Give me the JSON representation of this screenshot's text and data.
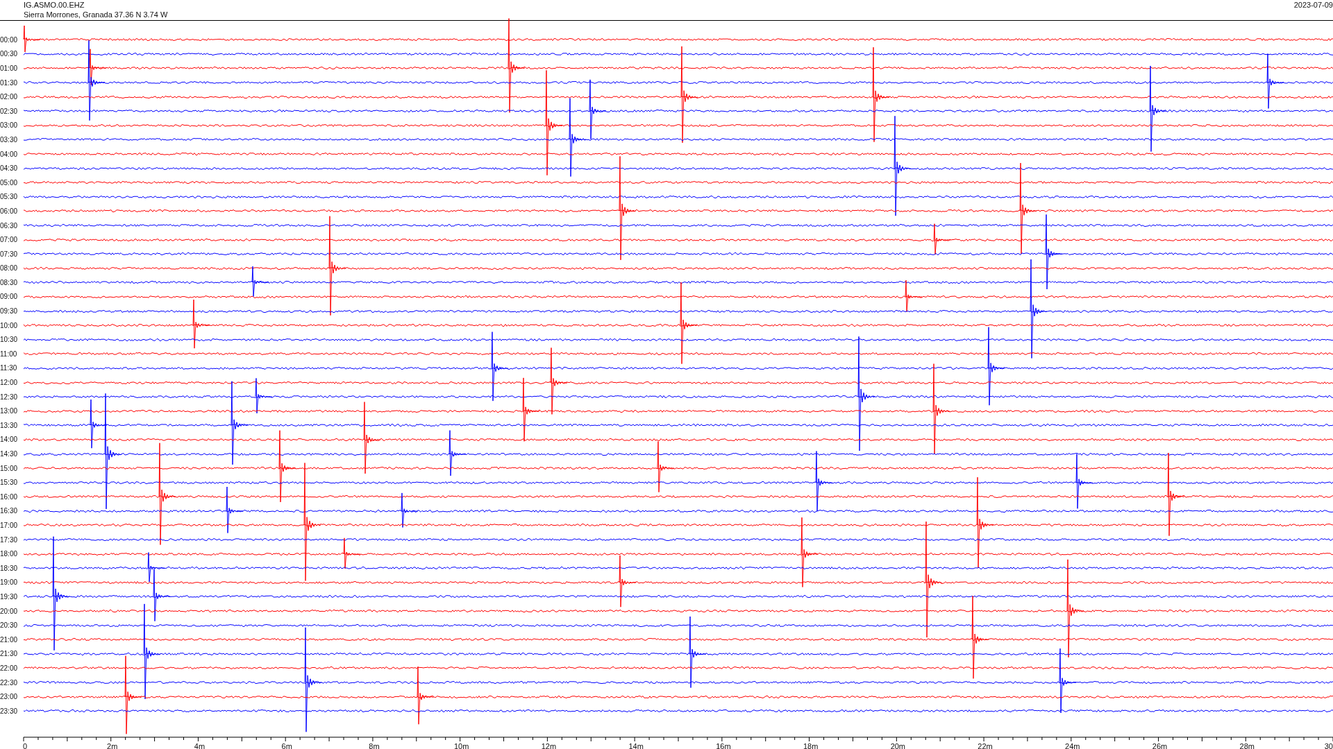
{
  "header": {
    "station": "IG.ASMO.00.EHZ",
    "location": "Sierra Morrones, Granada  37.36 N 3.74 W",
    "date": "2023-07-09"
  },
  "rows": [
    {
      "time": "00:00",
      "color": "#ff0000"
    },
    {
      "time": "00:30",
      "color": "#0000ff"
    },
    {
      "time": "01:00",
      "color": "#ff0000"
    },
    {
      "time": "01:30",
      "color": "#0000ff"
    },
    {
      "time": "02:00",
      "color": "#ff0000"
    },
    {
      "time": "02:30",
      "color": "#0000ff"
    },
    {
      "time": "03:00",
      "color": "#ff0000"
    },
    {
      "time": "03:30",
      "color": "#0000ff"
    },
    {
      "time": "04:00",
      "color": "#ff0000"
    },
    {
      "time": "04:30",
      "color": "#0000ff"
    },
    {
      "time": "05:00",
      "color": "#ff0000"
    },
    {
      "time": "05:30",
      "color": "#0000ff"
    },
    {
      "time": "06:00",
      "color": "#ff0000"
    },
    {
      "time": "06:30",
      "color": "#0000ff"
    },
    {
      "time": "07:00",
      "color": "#ff0000"
    },
    {
      "time": "07:30",
      "color": "#0000ff"
    },
    {
      "time": "08:00",
      "color": "#ff0000"
    },
    {
      "time": "08:30",
      "color": "#0000ff"
    },
    {
      "time": "09:00",
      "color": "#ff0000"
    },
    {
      "time": "09:30",
      "color": "#0000ff"
    },
    {
      "time": "10:00",
      "color": "#ff0000"
    },
    {
      "time": "10:30",
      "color": "#0000ff"
    },
    {
      "time": "11:00",
      "color": "#ff0000"
    },
    {
      "time": "11:30",
      "color": "#0000ff"
    },
    {
      "time": "12:00",
      "color": "#ff0000"
    },
    {
      "time": "12:30",
      "color": "#0000ff"
    },
    {
      "time": "13:00",
      "color": "#ff0000"
    },
    {
      "time": "13:30",
      "color": "#0000ff"
    },
    {
      "time": "14:00",
      "color": "#ff0000"
    },
    {
      "time": "14:30",
      "color": "#0000ff"
    },
    {
      "time": "15:00",
      "color": "#ff0000"
    },
    {
      "time": "15:30",
      "color": "#0000ff"
    },
    {
      "time": "16:00",
      "color": "#ff0000"
    },
    {
      "time": "16:30",
      "color": "#0000ff"
    },
    {
      "time": "17:00",
      "color": "#ff0000"
    },
    {
      "time": "17:30",
      "color": "#0000ff"
    },
    {
      "time": "18:00",
      "color": "#ff0000"
    },
    {
      "time": "18:30",
      "color": "#0000ff"
    },
    {
      "time": "19:00",
      "color": "#ff0000"
    },
    {
      "time": "19:30",
      "color": "#0000ff"
    },
    {
      "time": "20:00",
      "color": "#ff0000"
    },
    {
      "time": "20:30",
      "color": "#0000ff"
    },
    {
      "time": "21:00",
      "color": "#ff0000"
    },
    {
      "time": "21:30",
      "color": "#0000ff"
    },
    {
      "time": "22:00",
      "color": "#ff0000"
    },
    {
      "time": "22:30",
      "color": "#0000ff"
    },
    {
      "time": "23:00",
      "color": "#ff0000"
    },
    {
      "time": "23:30",
      "color": "#0000ff"
    }
  ],
  "x_axis": {
    "labels": [
      "0",
      "2m",
      "4m",
      "6m",
      "8m",
      "10m",
      "12m",
      "14m",
      "16m",
      "18m",
      "20m",
      "22m",
      "24m",
      "26m",
      "28m",
      "30"
    ]
  }
}
